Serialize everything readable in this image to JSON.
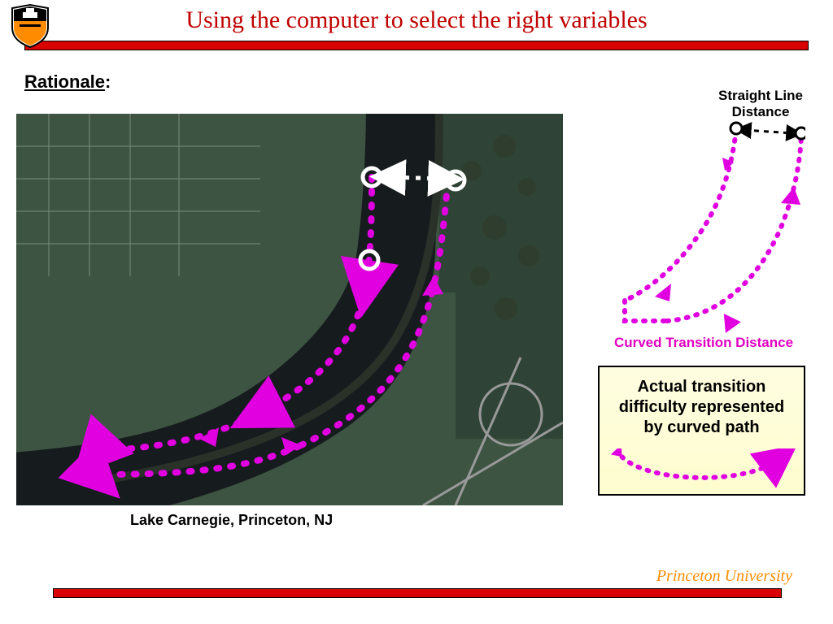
{
  "title": "Using the computer to select the right variables",
  "rationale_label": "Rationale",
  "rationale_colon": ":",
  "map_caption": "Lake Carnegie, Princeton, NJ",
  "straight_line_label": "Straight Line Distance",
  "curved_label": "Curved Transition Distance",
  "callout_text": "Actual transition difficulty represented by curved path",
  "footer_label": "Princeton University",
  "colors": {
    "accent_red": "#d90000",
    "title_red": "#c00000",
    "magenta": "#e000e0",
    "orange": "#ff8c00",
    "callout_bg": "#fffde0"
  }
}
